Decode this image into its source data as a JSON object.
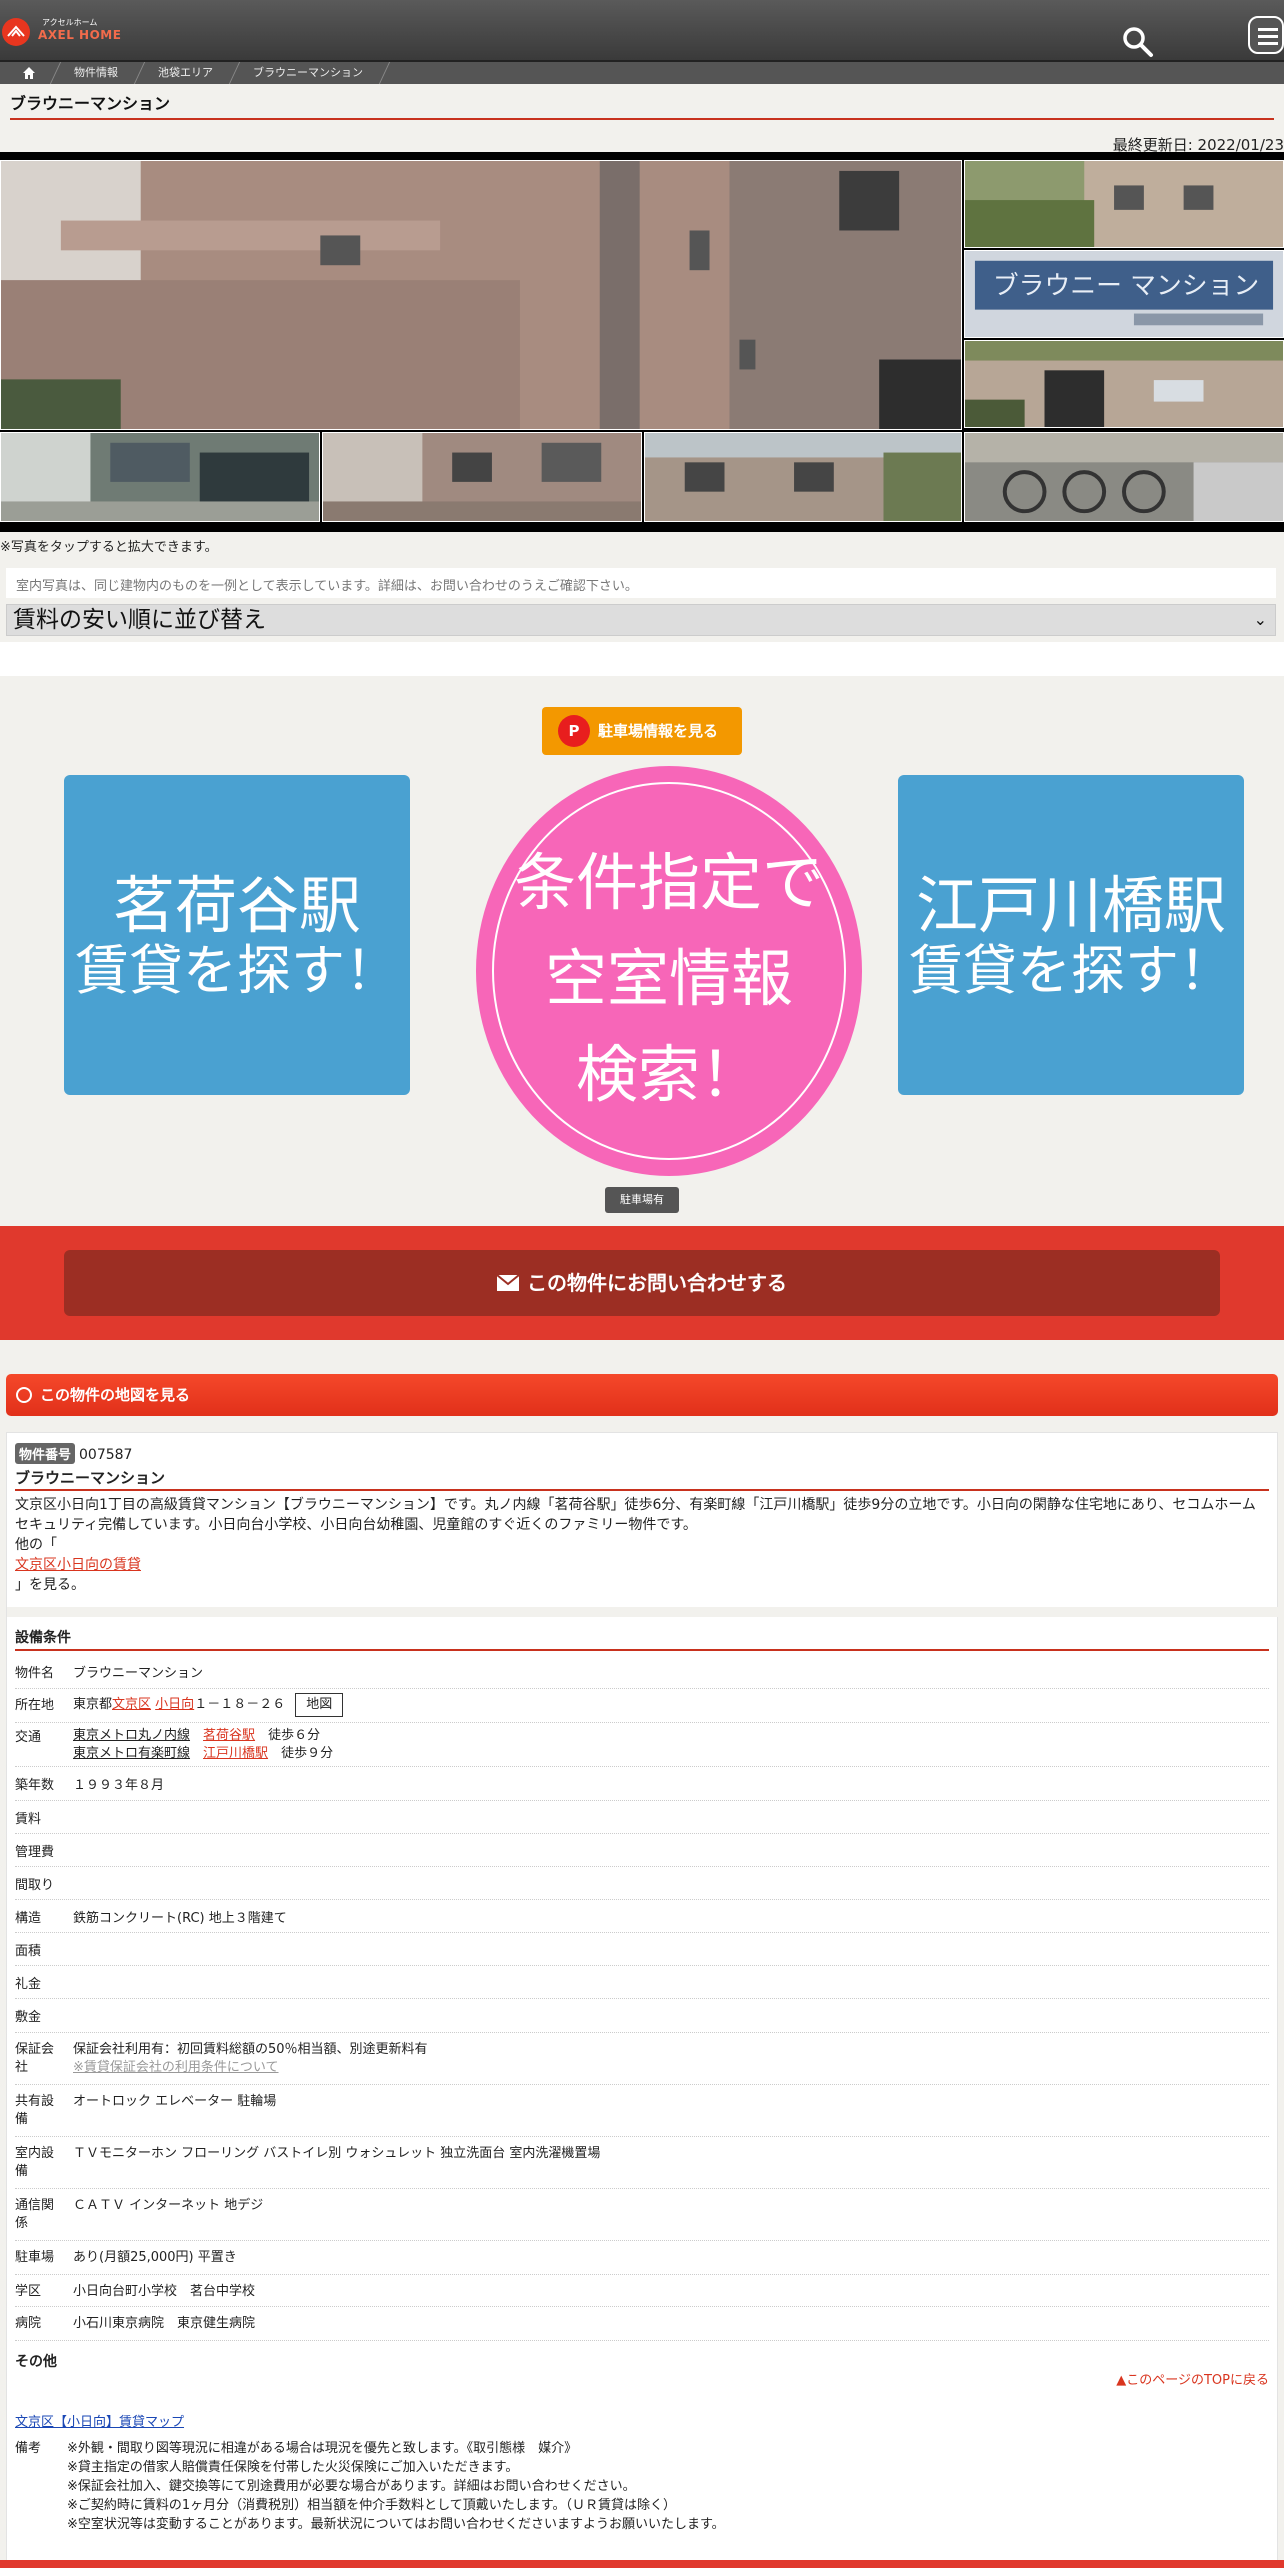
{
  "header": {
    "logo_small": "アクセルホーム",
    "logo_big": "AXEL HOME",
    "search_icon": "search-icon",
    "menu_icon": "hamburger-menu-icon"
  },
  "breadcrumb": [
    "物件情報",
    "池袋エリア",
    "ブラウニーマンション"
  ],
  "page_title": "ブラウニーマンション",
  "last_updated": "最終更新日: 2022/01/23",
  "gallery": {
    "tap_note": "※写真をタップすると拡大できます。"
  },
  "notice": "室内写真は、同じ建物内のものを一例として表示しています。詳細は、お問い合わせのうえご確認下さい。",
  "sort_select": {
    "selected": "賃料の安い順に並び替え"
  },
  "promo": {
    "parking_button": "駐車場情報を見る",
    "parking_icon_letter": "P",
    "left_station": {
      "name": "茗荷谷駅",
      "sub": "賃貸を探す！"
    },
    "center_search": [
      "条件指定で",
      "空室情報",
      "検索！"
    ],
    "right_station": {
      "name": "江戸川橋駅",
      "sub": "賃貸を探す！"
    },
    "parking_tag": "駐車場有"
  },
  "contact_button": "この物件にお問い合わせする",
  "map_bar": "この物件の地図を見る",
  "property": {
    "id_label": "物件番号",
    "id": "007587",
    "name": "ブラウニーマンション",
    "description": "文京区小日向1丁目の高級賃貸マンション【ブラウニーマンション】です。丸ノ内線「茗荷谷駅」徒歩6分、有楽町線「江戸川橋駅」徒歩9分の立地です。小日向の閑静な住宅地にあり、セコムホームセキュリティ完備しています。小日向台小学校、小日向台幼稚園、児童館のすぐ近くのファミリー物件です。",
    "other_prefix": "他の「",
    "other_link": "文京区小日向の賃貸",
    "other_suffix": "」を見る。"
  },
  "specs": {
    "section_title": "設備条件",
    "rows": [
      {
        "label": "物件名",
        "value": "ブラウニーマンション"
      },
      {
        "label": "所在地",
        "prefix": "東京都",
        "link1": "文京区",
        "link2": "小日向",
        "rest": "１－１８－２６",
        "map_button": "地図"
      },
      {
        "label": "交通",
        "line1": "東京メトロ丸ノ内線",
        "st1": "茗荷谷駅",
        "walk1": "徒歩６分",
        "line2": "東京メトロ有楽町線",
        "st2": "江戸川橋駅",
        "walk2": "徒歩９分"
      },
      {
        "label": "築年数",
        "value": "１９９３年８月"
      },
      {
        "label": "賃料",
        "value": ""
      },
      {
        "label": "管理費",
        "value": ""
      },
      {
        "label": "間取り",
        "value": ""
      },
      {
        "label": "構造",
        "value": "鉄筋コンクリート(RC) 地上３階建て"
      },
      {
        "label": "面積",
        "value": ""
      },
      {
        "label": "礼金",
        "value": ""
      },
      {
        "label": "敷金",
        "value": ""
      },
      {
        "label": "保証会社",
        "value": "保証会社利用有：初回賃料総額の50％相当額、別途更新料有",
        "link": "※賃貸保証会社の利用条件について"
      },
      {
        "label": "共有設備",
        "value": "オートロック エレベーター 駐輪場"
      },
      {
        "label": "室内設備",
        "value": "ＴＶモニターホン フローリング バストイレ別 ウォシュレット 独立洗面台 室内洗濯機置場"
      },
      {
        "label": "通信関係",
        "value": "ＣＡＴＶ インターネット 地デジ"
      },
      {
        "label": "駐車場",
        "value": "あり(月額25,000円) 平置き"
      },
      {
        "label": "学区",
        "value": "小日向台町小学校　茗台中学校"
      },
      {
        "label": "病院",
        "value": "小石川東京病院　東京健生病院"
      }
    ],
    "other_title": "その他",
    "top_link": "▲このページのTOPに戻る",
    "map_link": "文京区【小日向】賃貸マップ",
    "remarks_label": "備考",
    "remarks": [
      "※外観・間取り図等現況に相違がある場合は現況を優先と致します。《取引態様　媒介》",
      "※貸主指定の借家人賠償責任保険を付帯した火災保険にご加入いただきます。",
      "※保証会社加入、鍵交換等にて別途費用が必要な場合があります。詳細はお問い合わせください。",
      "※ご契約時に賃料の1ヶ月分（消費税別）相当額を仲介手数料として頂戴いたします。（ＵＲ賃貸は除く）",
      "※空室状況等は変動することがあります。最新状況についてはお問い合わせくださいますようお願いいたします。"
    ]
  },
  "colors": {
    "accent_red": "#e0392d",
    "station_blue": "#4aa1d1",
    "search_pink": "#f766b8",
    "parking_orange": "#f39800"
  }
}
